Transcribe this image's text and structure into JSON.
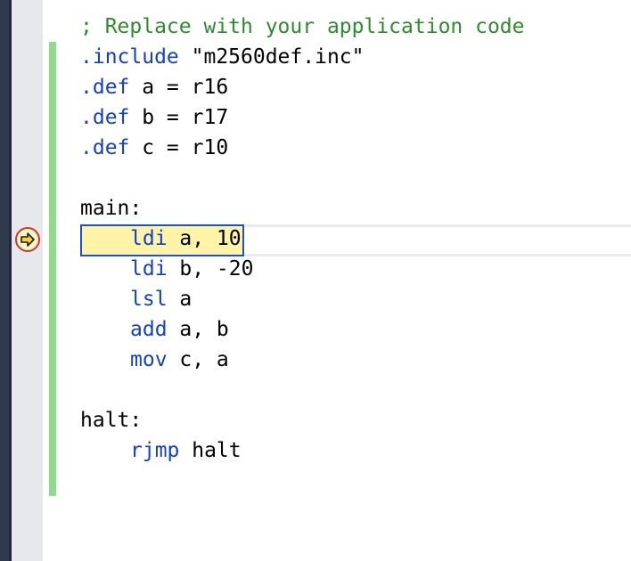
{
  "editor": {
    "theme_colors": {
      "comment": "#2e8b2e",
      "keyword": "#1240c8",
      "text": "#000000",
      "execution_highlight": "#fff3a8",
      "change_bar": "#8fdc8a"
    },
    "current_execution_line": 8,
    "lines": [
      {
        "kind": "comment",
        "text": "; Replace with your application code"
      },
      {
        "kind": "directive",
        "keyword": ".include",
        "rest": " \"m2560def.inc\""
      },
      {
        "kind": "directive",
        "keyword": ".def",
        "rest": " a = r16"
      },
      {
        "kind": "directive",
        "keyword": ".def",
        "rest": " b = r17"
      },
      {
        "kind": "directive",
        "keyword": ".def",
        "rest": " c = r10"
      },
      {
        "kind": "blank",
        "text": ""
      },
      {
        "kind": "label",
        "text": "main:"
      },
      {
        "kind": "instruction",
        "keyword": "ldi",
        "rest": " a, 10"
      },
      {
        "kind": "instruction",
        "keyword": "ldi",
        "rest": " b, -20"
      },
      {
        "kind": "instruction",
        "keyword": "lsl",
        "rest": " a"
      },
      {
        "kind": "instruction",
        "keyword": "add",
        "rest": " a, b"
      },
      {
        "kind": "instruction",
        "keyword": "mov",
        "rest": " c, a"
      },
      {
        "kind": "blank",
        "text": ""
      },
      {
        "kind": "label",
        "text": "halt:"
      },
      {
        "kind": "instruction",
        "keyword": "rjmp",
        "rest": " halt"
      }
    ]
  }
}
